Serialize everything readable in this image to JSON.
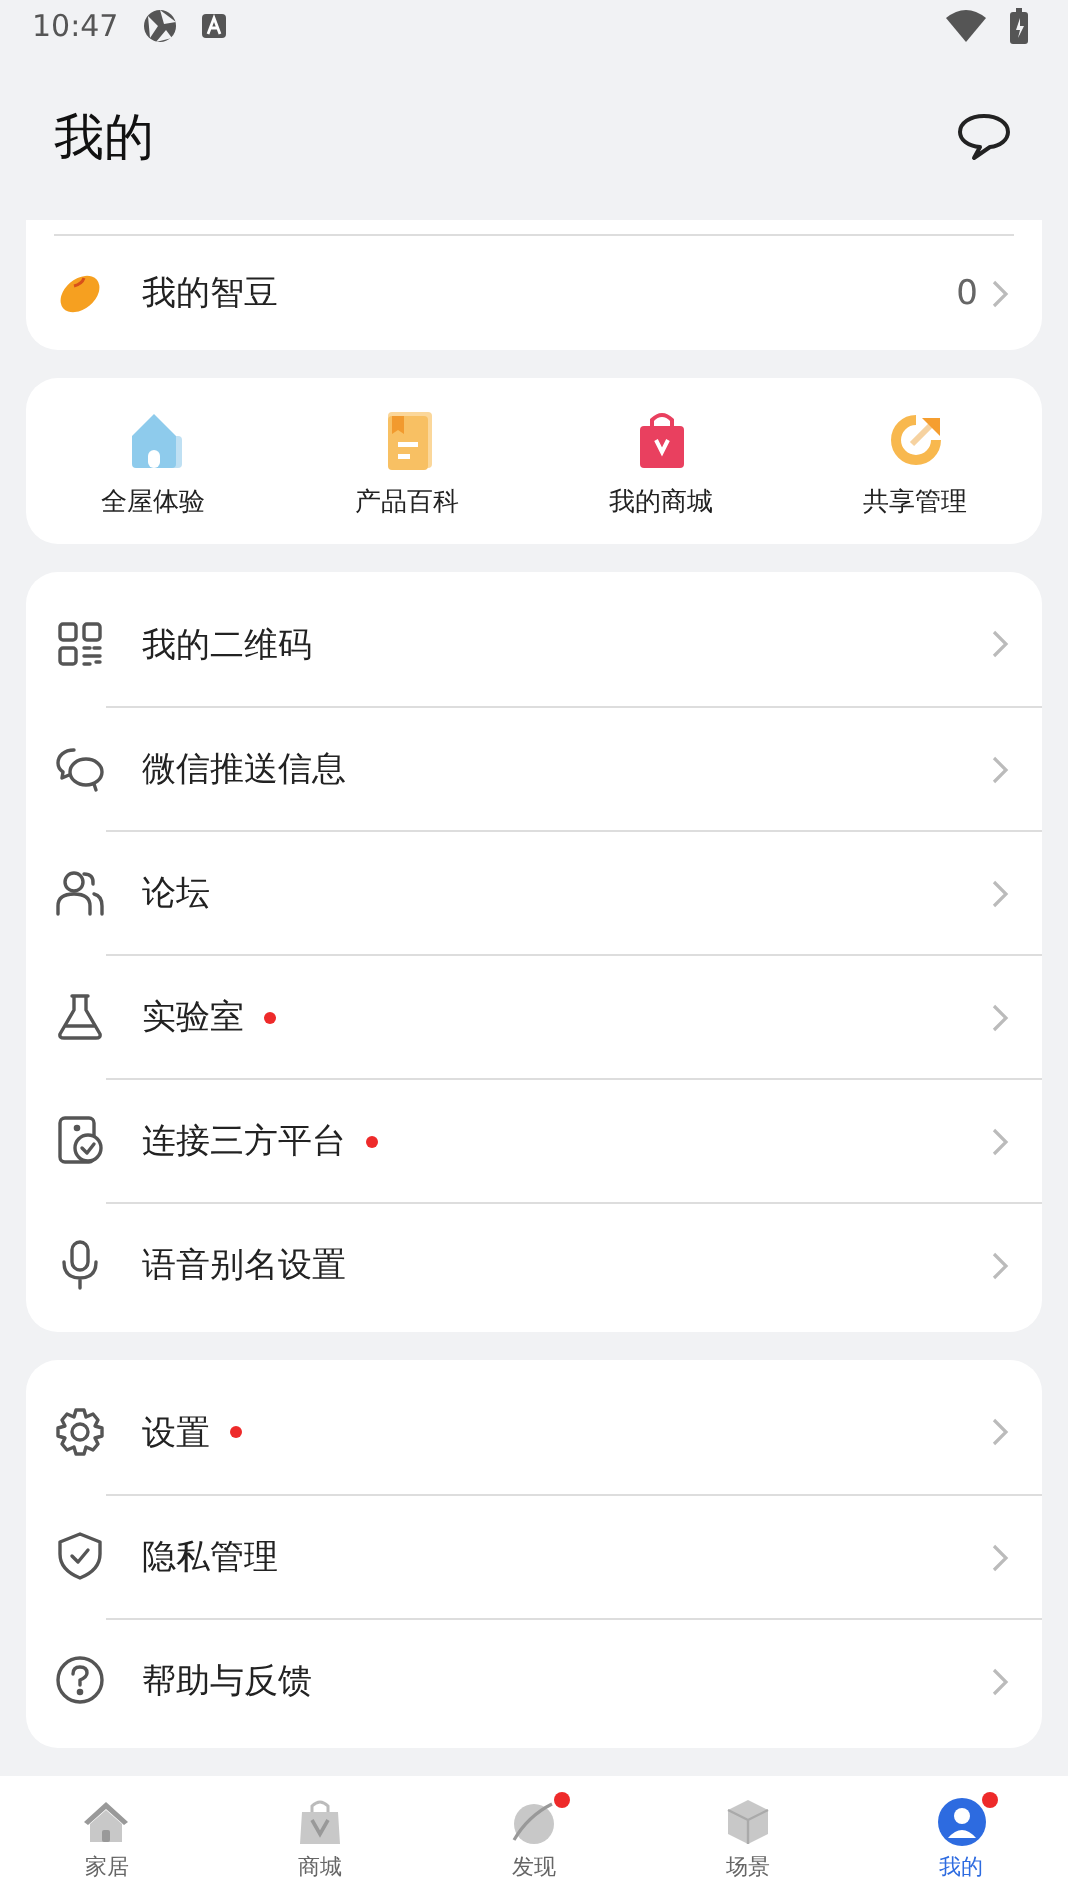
{
  "status_bar": {
    "time": "10:47"
  },
  "header": {
    "title": "我的"
  },
  "beans": {
    "label": "我的智豆",
    "count": "0"
  },
  "shortcuts": [
    {
      "label": "全屋体验",
      "kind": "house"
    },
    {
      "label": "产品百科",
      "kind": "book"
    },
    {
      "label": "我的商城",
      "kind": "bag"
    },
    {
      "label": "共享管理",
      "kind": "share"
    }
  ],
  "menu_groups": [
    [
      {
        "label": "我的二维码",
        "kind": "qr",
        "badge": false
      },
      {
        "label": "微信推送信息",
        "kind": "chat",
        "badge": false
      },
      {
        "label": "论坛",
        "kind": "people",
        "badge": false
      },
      {
        "label": "实验室",
        "kind": "flask",
        "badge": true
      },
      {
        "label": "连接三方平台",
        "kind": "link",
        "badge": true
      },
      {
        "label": "语音别名设置",
        "kind": "mic",
        "badge": false
      }
    ],
    [
      {
        "label": "设置",
        "kind": "gear",
        "badge": true
      },
      {
        "label": "隐私管理",
        "kind": "shield",
        "badge": false
      },
      {
        "label": "帮助与反馈",
        "kind": "help",
        "badge": false
      }
    ]
  ],
  "nav": [
    {
      "label": "家居",
      "kind": "home",
      "selected": false,
      "badge": false
    },
    {
      "label": "商城",
      "kind": "store",
      "selected": false,
      "badge": false
    },
    {
      "label": "发现",
      "kind": "planet",
      "selected": false,
      "badge": true
    },
    {
      "label": "场景",
      "kind": "cube",
      "selected": false,
      "badge": false
    },
    {
      "label": "我的",
      "kind": "user",
      "selected": true,
      "badge": true
    }
  ]
}
